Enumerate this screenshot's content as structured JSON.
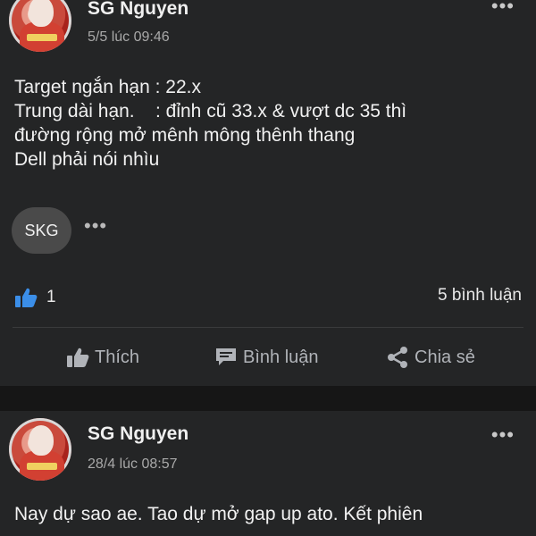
{
  "posts": [
    {
      "author": "SG Nguyen",
      "time": "5/5 lúc 09:46",
      "content_lines": [
        "Target ngắn hạn : 22.x",
        "Trung dài hạn.    : đỉnh cũ 33.x & vượt dc 35 thì",
        "đường rộng mở mênh mông thênh thang",
        "Dell phải nói nhìu"
      ],
      "tag_chip": "SKG",
      "like_count": "1",
      "comment_count": "5 bình luận",
      "actions": {
        "like": "Thích",
        "comment": "Bình luận",
        "share": "Chia sẻ"
      }
    },
    {
      "author": "SG Nguyen",
      "time": "28/4 lúc 08:57",
      "content_lines": [
        "Nay dự sao ae. Tao dự mở gap up ato. Kết phiên"
      ]
    }
  ],
  "icons": {
    "more": "more-dots-icon",
    "like_reaction": "thumbs-up-icon",
    "comment": "comment-icon",
    "share": "share-icon"
  },
  "colors": {
    "background": "#242526",
    "separator": "#161616",
    "like_blue": "#3b8ee8",
    "muted": "#b0b3b8"
  }
}
